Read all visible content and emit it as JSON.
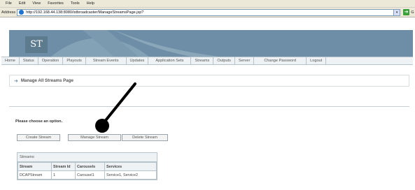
{
  "menu": [
    "File",
    "Edit",
    "View",
    "Favorites",
    "Tools",
    "Help"
  ],
  "address": {
    "label": "Address",
    "url": "http://192.168.44.138:8080/istbroadcaster/ManageStreamsPage.jsp?",
    "go": "G"
  },
  "logo": "ST",
  "nav": [
    "Home",
    "Status",
    "Operation",
    "Playouts",
    "Stream Events",
    "Updates",
    "Application Sets",
    "Streams",
    "Outputs",
    "Server",
    "Change Password",
    "Logout"
  ],
  "page": {
    "title": "Manage All Streams Page",
    "prompt": "Please choose an option.",
    "buttons": {
      "create": "Create Stream",
      "manage": "Manage Stream",
      "delete": "Delete Stream"
    }
  },
  "streams_table": {
    "caption": "Streams",
    "headers": [
      "Stream",
      "Stream Id",
      "Carousels",
      "Services"
    ],
    "rows": [
      [
        "DCAPStream",
        "1",
        "Carousel1",
        "Service1, Service2"
      ]
    ]
  },
  "colors": {
    "banner": "#6d8ea6",
    "nav_bg": "#eef2f4"
  }
}
